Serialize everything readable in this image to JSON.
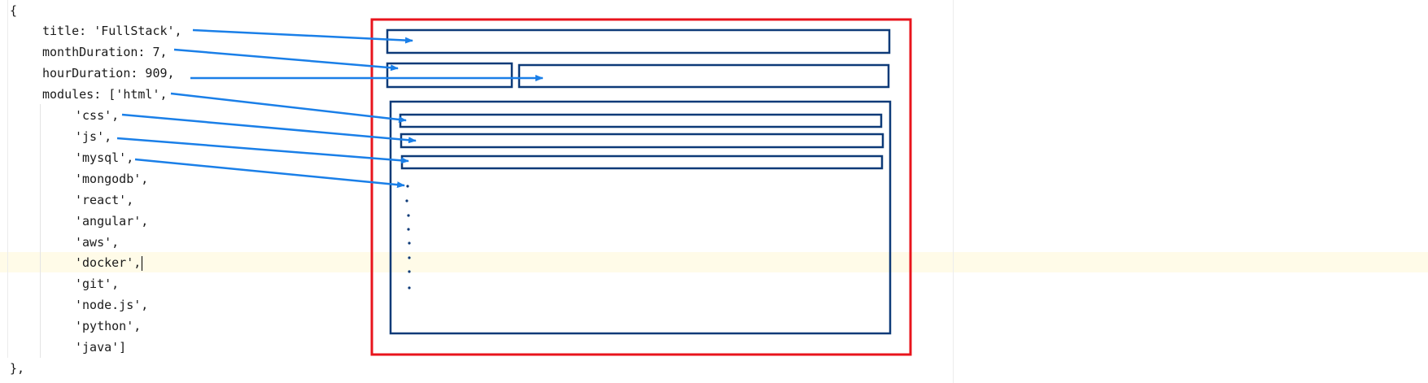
{
  "code": {
    "open_brace": "{",
    "title_line": "title: 'FullStack',",
    "month_line": "monthDuration: 7,",
    "hour_line": "hourDuration: 909,",
    "modules_line": "modules: ['html',",
    "modules": [
      "'css',",
      "'js',",
      "'mysql',",
      "'mongodb',",
      "'react',",
      "'angular',",
      "'aws',",
      "'docker',",
      "'git',",
      "'node.js',",
      "'python',",
      "'java']"
    ],
    "close_brace": "},"
  },
  "colors": {
    "outer_frame": "#e8141c",
    "boxes": "#0d3a78",
    "arrows": "#1a7fe8",
    "highlight": "#fffbe8"
  },
  "icons": [
    "arrow-icon",
    "ellipsis-dots-icon"
  ]
}
